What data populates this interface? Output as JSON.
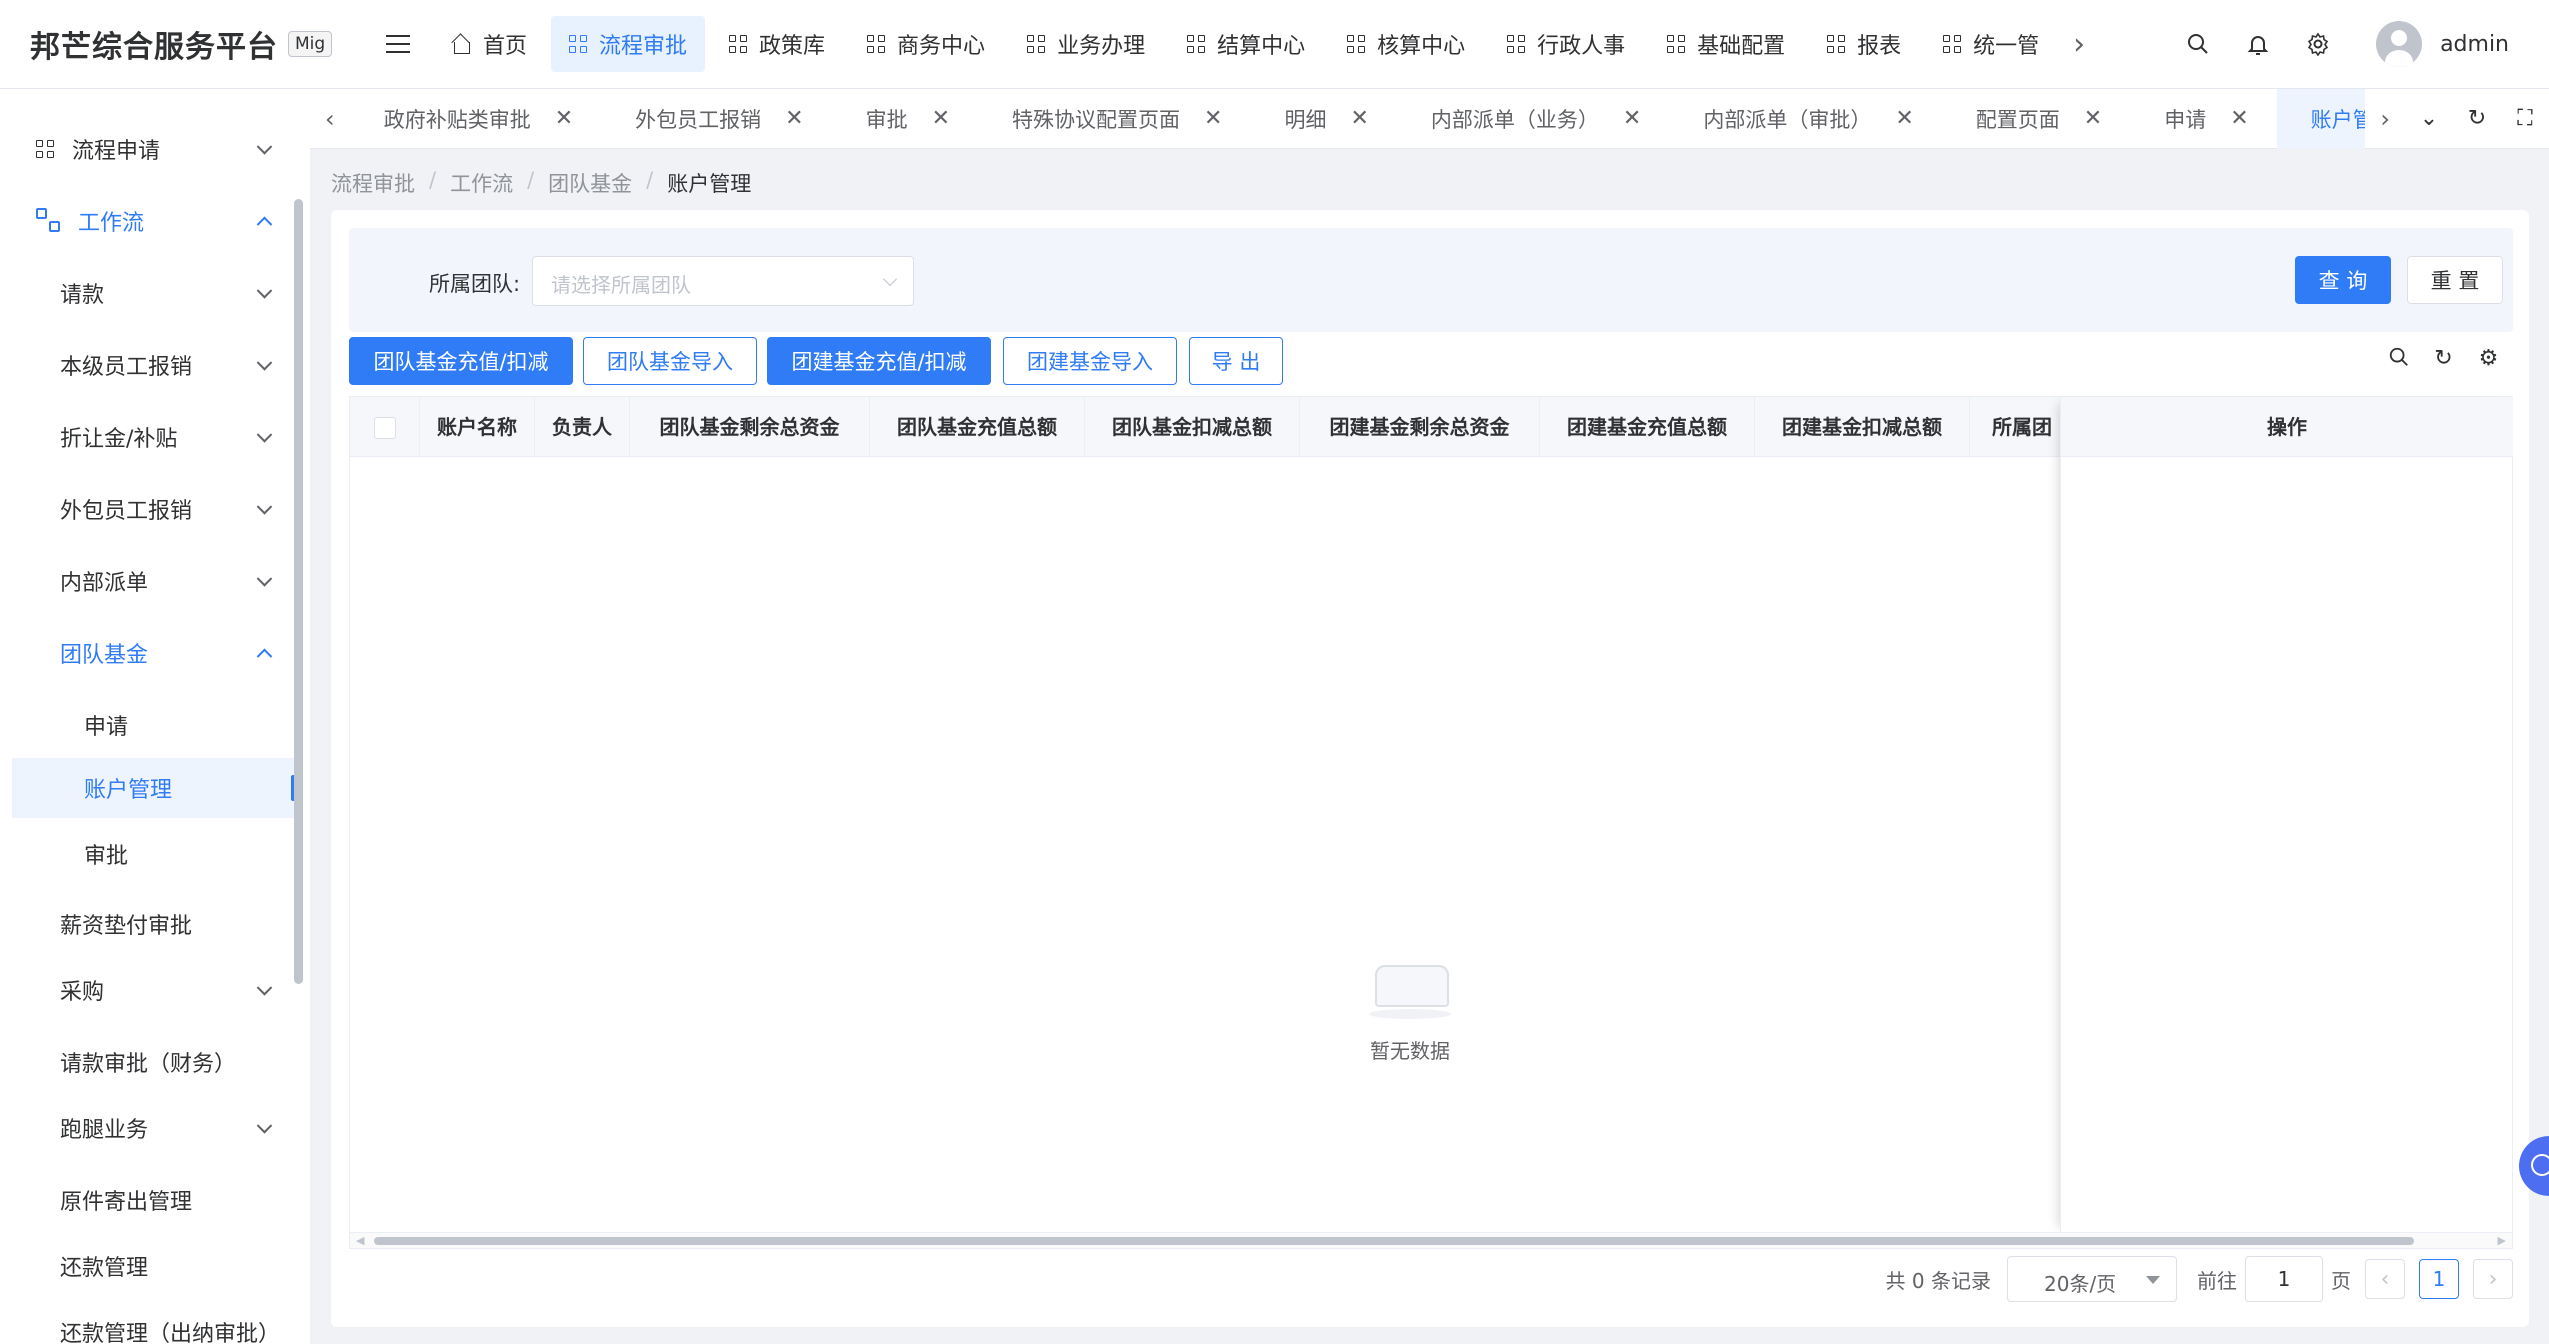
{
  "brand": {
    "title": "邦芒综合服务平台",
    "tag": "Mig"
  },
  "topnav": {
    "items": [
      {
        "label": "首页",
        "icon": "home-icon",
        "active": false
      },
      {
        "label": "流程审批",
        "icon": "grid-icon",
        "active": true
      },
      {
        "label": "政策库",
        "icon": "grid-icon",
        "active": false
      },
      {
        "label": "商务中心",
        "icon": "grid-icon",
        "active": false
      },
      {
        "label": "业务办理",
        "icon": "grid-icon",
        "active": false
      },
      {
        "label": "结算中心",
        "icon": "grid-icon",
        "active": false
      },
      {
        "label": "核算中心",
        "icon": "grid-icon",
        "active": false
      },
      {
        "label": "行政人事",
        "icon": "grid-icon",
        "active": false
      },
      {
        "label": "基础配置",
        "icon": "grid-icon",
        "active": false
      },
      {
        "label": "报表",
        "icon": "grid-icon",
        "active": false
      },
      {
        "label": "统一管",
        "icon": "grid-icon",
        "active": false
      }
    ],
    "username": "admin"
  },
  "sidebar": {
    "items": [
      {
        "label": "流程申请",
        "level": 0
      },
      {
        "label": "工作流",
        "level": 0
      },
      {
        "label": "请款",
        "level": 1
      },
      {
        "label": "本级员工报销",
        "level": 1
      },
      {
        "label": "折让金/补贴",
        "level": 1
      },
      {
        "label": "外包员工报销",
        "level": 1
      },
      {
        "label": "内部派单",
        "level": 1
      },
      {
        "label": "团队基金",
        "level": 1
      },
      {
        "label": "申请",
        "level": 2
      },
      {
        "label": "账户管理",
        "level": 2
      },
      {
        "label": "审批",
        "level": 2
      },
      {
        "label": "薪资垫付审批",
        "level": 1
      },
      {
        "label": "采购",
        "level": 1
      },
      {
        "label": "请款审批（财务）",
        "level": 1
      },
      {
        "label": "跑腿业务",
        "level": 1
      },
      {
        "label": "原件寄出管理",
        "level": 1
      },
      {
        "label": "还款管理",
        "level": 1
      },
      {
        "label": "还款管理（出纳审批）",
        "level": 1
      }
    ]
  },
  "tabs": [
    {
      "label": "政府补贴类审批",
      "active": false
    },
    {
      "label": "外包员工报销",
      "active": false
    },
    {
      "label": "审批",
      "active": false
    },
    {
      "label": "特殊协议配置页面",
      "active": false
    },
    {
      "label": "明细",
      "active": false
    },
    {
      "label": "内部派单（业务）",
      "active": false
    },
    {
      "label": "内部派单（审批）",
      "active": false
    },
    {
      "label": "配置页面",
      "active": false
    },
    {
      "label": "申请",
      "active": false
    },
    {
      "label": "账户管理",
      "active": true
    }
  ],
  "breadcrumb": [
    "流程审批",
    "工作流",
    "团队基金",
    "账户管理"
  ],
  "filter": {
    "label": "所属团队:",
    "placeholder": "请选择所属团队",
    "query_label": "查 询",
    "reset_label": "重 置"
  },
  "toolbar": {
    "team_recharge": "团队基金充值/扣减",
    "team_import": "团队基金导入",
    "build_recharge": "团建基金充值/扣减",
    "build_import": "团建基金导入",
    "export": "导 出"
  },
  "table": {
    "columns": [
      "账户名称",
      "负责人",
      "团队基金剩余总资金",
      "团队基金充值总额",
      "团队基金扣减总额",
      "团建基金剩余总资金",
      "团建基金充值总额",
      "团建基金扣减总额",
      "所属团"
    ],
    "op_column": "操作",
    "empty_text": "暂无数据"
  },
  "pagination": {
    "total_text": "共 0 条记录",
    "page_size": "20条/页",
    "goto_label": "前往",
    "goto_value": "1",
    "page_unit": "页",
    "current_page": "1"
  }
}
